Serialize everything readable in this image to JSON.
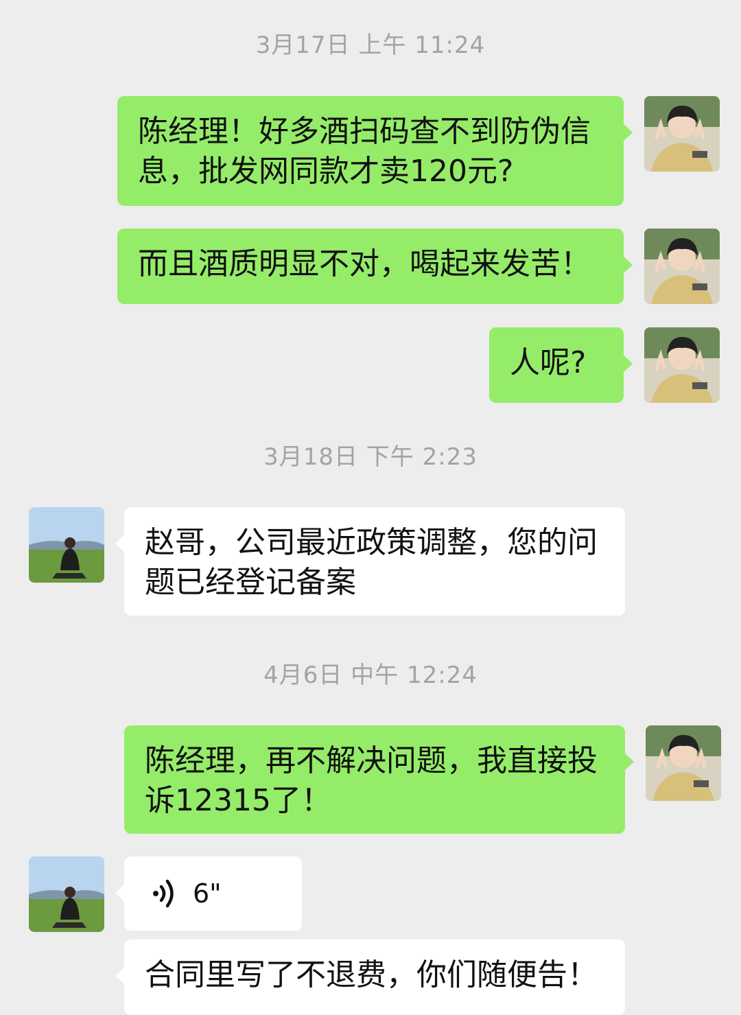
{
  "messages": [
    {
      "type": "time",
      "text": "3月17日 上午 11:24"
    },
    {
      "type": "me",
      "text": "陈经理！好多酒扫码查不到防伪信息，批发网同款才卖120元?"
    },
    {
      "type": "me",
      "text": "而且酒质明显不对，喝起来发苦！"
    },
    {
      "type": "me",
      "text": "人呢?"
    },
    {
      "type": "time",
      "text": "3月18日 下午 2:23"
    },
    {
      "type": "other",
      "text": "赵哥，公司最近政策调整，您的问题已经登记备案"
    },
    {
      "type": "time",
      "text": "4月6日 中午 12:24"
    },
    {
      "type": "me",
      "text": "陈经理，再不解决问题，我直接投诉12315了！"
    },
    {
      "type": "other_voice",
      "duration": "6\"",
      "icon": "voice-wave-icon"
    },
    {
      "type": "other",
      "text": "合同里写了不退费，你们随便告！"
    }
  ],
  "colors": {
    "background": "#ededed",
    "my_bubble": "#95ec69",
    "other_bubble": "#ffffff",
    "timestamp": "#a3a3a3"
  }
}
